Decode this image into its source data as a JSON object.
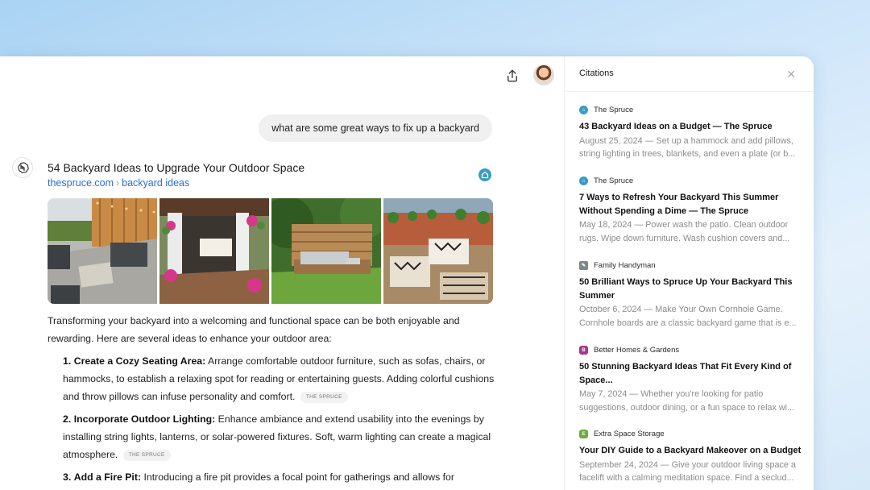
{
  "chat": {
    "user_message": "what are some great ways to fix up a backyard",
    "source": {
      "title": "54 Backyard Ideas to Upgrade Your Outdoor Space",
      "domain": "thespruce.com",
      "path": "backyard ideas"
    },
    "intro": "Transforming your backyard into a welcoming and functional space can be both enjoyable and rewarding. Here are several ideas to enhance your outdoor area:",
    "list": [
      {
        "num": "1.",
        "title": "Create a Cozy Seating Area:",
        "text": " Arrange comfortable outdoor furniture, such as sofas, chairs, or hammocks, to establish a relaxing spot for reading or entertaining guests. Adding colorful cushions and throw pillows can infuse personality and comfort.",
        "tag": "THE SPRUCE"
      },
      {
        "num": "2.",
        "title": "Incorporate Outdoor Lighting:",
        "text": " Enhance ambiance and extend usability into the evenings by installing string lights, lanterns, or solar-powered fixtures. Soft, warm lighting can create a magical atmosphere.",
        "tag": "THE SPRUCE"
      },
      {
        "num": "3.",
        "title": "Add a Fire Pit:",
        "text": " Introducing a fire pit provides a focal point for gatherings and allows for enjoyable",
        "tag": ""
      }
    ]
  },
  "citations": {
    "title": "Citations",
    "items": [
      {
        "source": "The Spruce",
        "icon_color": "#3a9bc4",
        "title": "43 Backyard Ideas on a Budget — The Spruce",
        "snippet": "August 25, 2024 — Set up a hammock and add pillows, string lighting in trees, blankets, and even a plate (or b..."
      },
      {
        "source": "The Spruce",
        "icon_color": "#3a9bc4",
        "title": "7 Ways to Refresh Your Backyard This Summer Without Spending a Dime — The Spruce",
        "snippet": "May 18, 2024 — Power wash the patio. Clean outdoor rugs. Wipe down furniture. Wash cushion covers and..."
      },
      {
        "source": "Family Handyman",
        "icon_color": "#7a8a8a",
        "title": "50 Brilliant Ways to Spruce Up Your Backyard This Summer",
        "snippet": "October 6, 2024 — Make Your Own Cornhole Game. Cornhole boards are a classic backyard game that is e..."
      },
      {
        "source": "Better Homes & Gardens",
        "icon_color": "#a8348c",
        "title": "50 Stunning Backyard Ideas That Fit Every Kind of Space...",
        "snippet": "May 7, 2024 — Whether you're looking for patio suggestions, outdoor dining, or a fun space to relax wi..."
      },
      {
        "source": "Extra Space Storage",
        "icon_color": "#6aab3a",
        "title": "Your DIY Guide to a Backyard Makeover on a Budget",
        "snippet": "September 24, 2024 — Give your outdoor living space a facelift with a calming meditation space. Find a seclud..."
      }
    ]
  }
}
